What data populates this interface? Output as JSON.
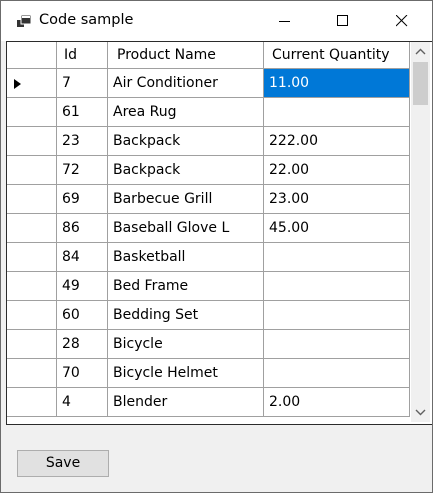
{
  "window": {
    "title": "Code sample",
    "icon": "windows-form-icon",
    "controls": [
      "minimize-icon",
      "maximize-icon",
      "close-icon"
    ]
  },
  "grid": {
    "columns": [
      "Id",
      "Product Name",
      "Current Quantity"
    ],
    "rows": [
      {
        "id": "7",
        "name": "Air Conditioner",
        "qty": "11.00",
        "current": true
      },
      {
        "id": "61",
        "name": "Area Rug",
        "qty": ""
      },
      {
        "id": "23",
        "name": "Backpack",
        "qty": "222.00"
      },
      {
        "id": "72",
        "name": "Backpack",
        "qty": "22.00"
      },
      {
        "id": "69",
        "name": "Barbecue Grill",
        "qty": "23.00"
      },
      {
        "id": "86",
        "name": "Baseball Glove L",
        "qty": "45.00"
      },
      {
        "id": "84",
        "name": "Basketball",
        "qty": ""
      },
      {
        "id": "49",
        "name": "Bed Frame",
        "qty": ""
      },
      {
        "id": "60",
        "name": "Bedding Set",
        "qty": ""
      },
      {
        "id": "28",
        "name": "Bicycle",
        "qty": ""
      },
      {
        "id": "70",
        "name": "Bicycle Helmet",
        "qty": ""
      },
      {
        "id": "4",
        "name": "Blender",
        "qty": "2.00"
      }
    ],
    "selected_cell": {
      "row": 0,
      "column": "Current Quantity"
    }
  },
  "footer": {
    "save_label": "Save"
  }
}
